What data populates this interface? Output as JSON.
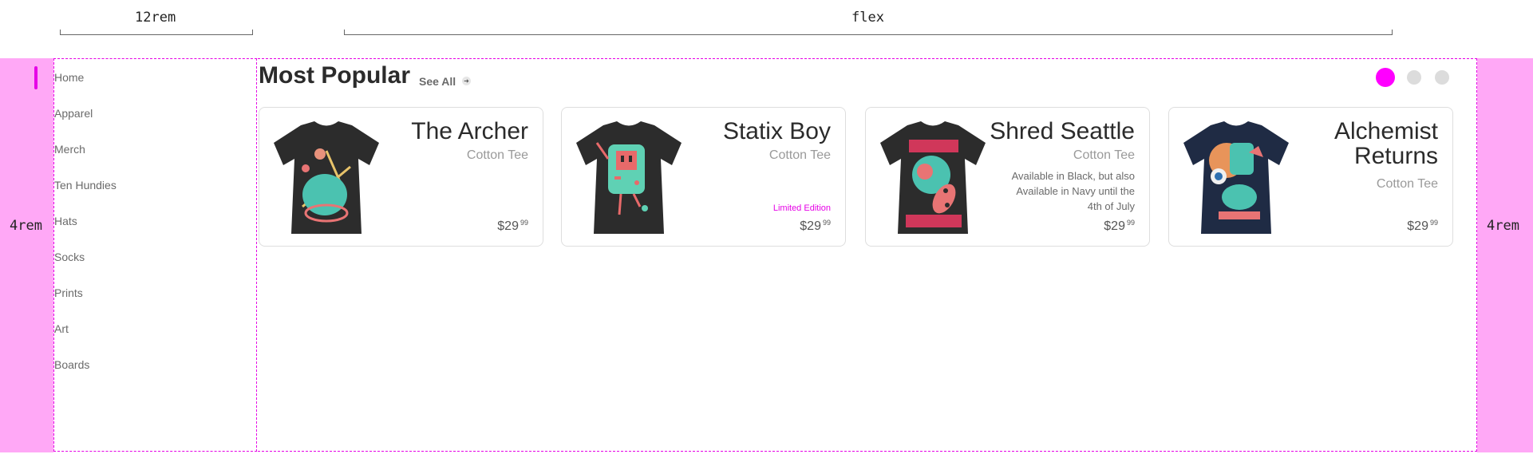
{
  "annotations": {
    "sidebar_width": "12rem",
    "main_width": "flex",
    "left_margin": "4rem",
    "right_margin": "4rem"
  },
  "nav": {
    "items": [
      "Home",
      "Apparel",
      "Merch",
      "Ten Hundies",
      "Hats",
      "Socks",
      "Prints",
      "Art",
      "Boards"
    ]
  },
  "section": {
    "title": "Most Popular",
    "see_all": "See All",
    "carousel_pages": 3,
    "active_page": 1
  },
  "products": [
    {
      "name": "The Archer",
      "subtitle": "Cotton Tee",
      "note": "",
      "badge": "",
      "price_dollars": "$29",
      "price_cents": "99",
      "shirt_color": "#2c2c2c"
    },
    {
      "name": "Statix Boy",
      "subtitle": "Cotton Tee",
      "note": "",
      "badge": "Limited Edition",
      "price_dollars": "$29",
      "price_cents": "99",
      "shirt_color": "#2c2c2c"
    },
    {
      "name": "Shred Seattle",
      "subtitle": "Cotton Tee",
      "note": "Available in Black, but also Available in Navy until the 4th of July",
      "badge": "",
      "price_dollars": "$29",
      "price_cents": "99",
      "shirt_color": "#2c2c2c"
    },
    {
      "name": "Alchemist Returns",
      "subtitle": "Cotton Tee",
      "note": "",
      "badge": "",
      "price_dollars": "$29",
      "price_cents": "99",
      "shirt_color": "#1f2b44"
    }
  ],
  "colors": {
    "accent": "#ff00ff",
    "margin": "#ffa8f6",
    "dot_inactive": "#dcdcdc"
  }
}
